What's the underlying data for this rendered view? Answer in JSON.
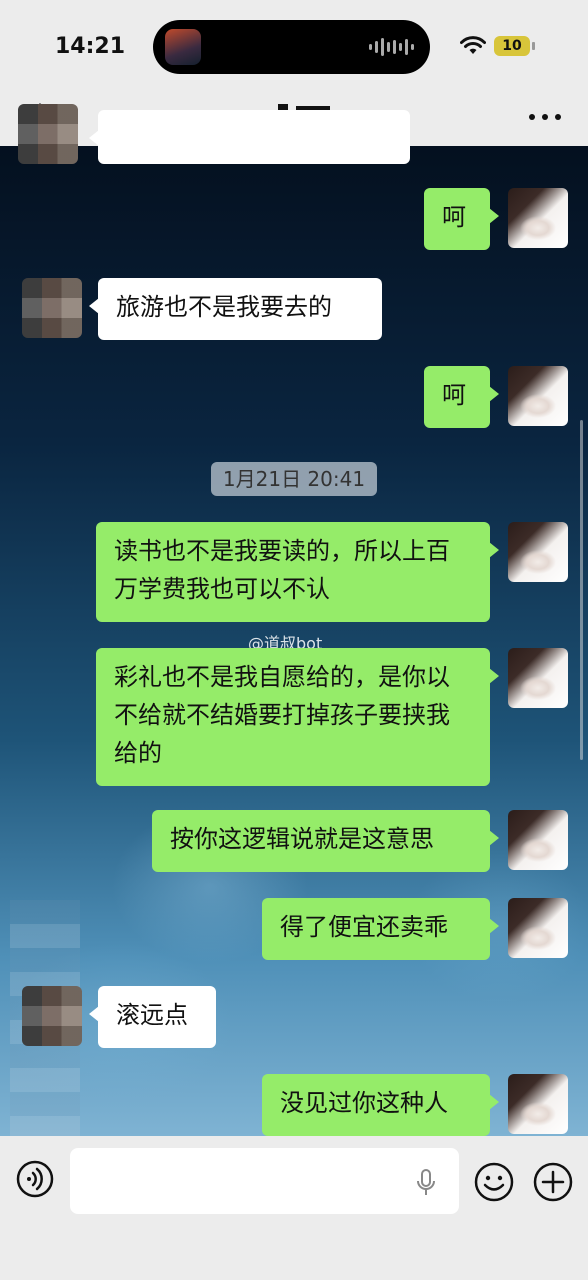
{
  "status_bar": {
    "time": "14:21",
    "battery": "10"
  },
  "header": {
    "title_redacted": "ᆩ丅"
  },
  "messages": [
    {
      "side": "me",
      "text": "呵"
    },
    {
      "side": "other",
      "text": "旅游也不是我要去的"
    },
    {
      "side": "me",
      "text": "呵"
    },
    {
      "side": "me",
      "text": "读书也不是我要读的，所以上百万学费我也可以不认"
    },
    {
      "side": "me",
      "text": "彩礼也不是我自愿给的，是你以不给就不结婚要打掉孩子要挟我给的"
    },
    {
      "side": "me",
      "text": "按你这逻辑说就是这意思"
    },
    {
      "side": "me",
      "text": "得了便宜还卖乖"
    },
    {
      "side": "other",
      "text": "滚远点"
    },
    {
      "side": "me",
      "text": "没见过你这种人"
    }
  ],
  "timestamp": "1月21日 20:41",
  "watermark": "@道叔bot",
  "input": {
    "placeholder": ""
  },
  "colors": {
    "my_bubble": "#95ec69",
    "other_bubble": "#ffffff",
    "bar": "#ececec"
  }
}
